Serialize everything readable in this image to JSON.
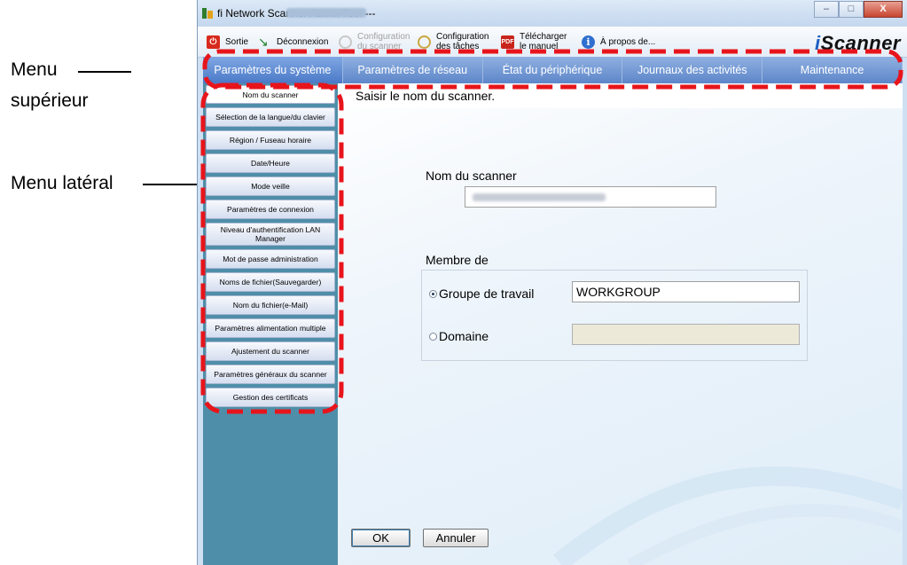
{
  "callouts": {
    "top_menu_line1": "Menu",
    "top_menu_line2": "supérieur",
    "side_menu": "Menu latéral"
  },
  "window": {
    "title": "fi Network Scanner Admin Tool ---",
    "controls": [
      "–",
      "□",
      "X"
    ]
  },
  "toolbar": {
    "sortie": "Sortie",
    "deconnexion": "Déconnexion",
    "config_scanner": [
      "Configuration",
      "du scanner"
    ],
    "config_taches": [
      "Configuration",
      "des tâches"
    ],
    "telecharger": [
      "Télécharger",
      "le manuel"
    ],
    "a_propos": "À propos de...",
    "logo_i": "i",
    "logo_rest": "Scanner"
  },
  "top_menu": [
    "Paramètres du système",
    "Paramètres de réseau",
    "État du périphérique",
    "Journaux des activités",
    "Maintenance"
  ],
  "side_menu": [
    "Nom du scanner",
    "Sélection de la langue/du clavier",
    "Région / Fuseau horaire",
    "Date/Heure",
    "Mode veille",
    "Paramètres de connexion",
    "Niveau d'authentification LAN Manager",
    "Mot de passe administration",
    "Noms de fichier(Sauvegarder)",
    "Nom du fichier(e-Mail)",
    "Paramètres alimentation multiple",
    "Ajustement du scanner",
    "Paramètres généraux du scanner",
    "Gestion des certificats"
  ],
  "content": {
    "instruction": "Saisir le nom du scanner.",
    "name_label": "Nom du scanner",
    "membre_label": "Membre de",
    "workgroup_label": "Groupe de travail",
    "workgroup_value": "WORKGROUP",
    "workgroup_selected": true,
    "domain_label": "Domaine",
    "domain_value": ""
  },
  "buttons": {
    "ok": "OK",
    "cancel": "Annuler"
  },
  "colors": {
    "annotation_dash": "#e8141b",
    "top_menu_bg": "#5d86c9",
    "sidebar_bg": "#4f8ea8"
  }
}
